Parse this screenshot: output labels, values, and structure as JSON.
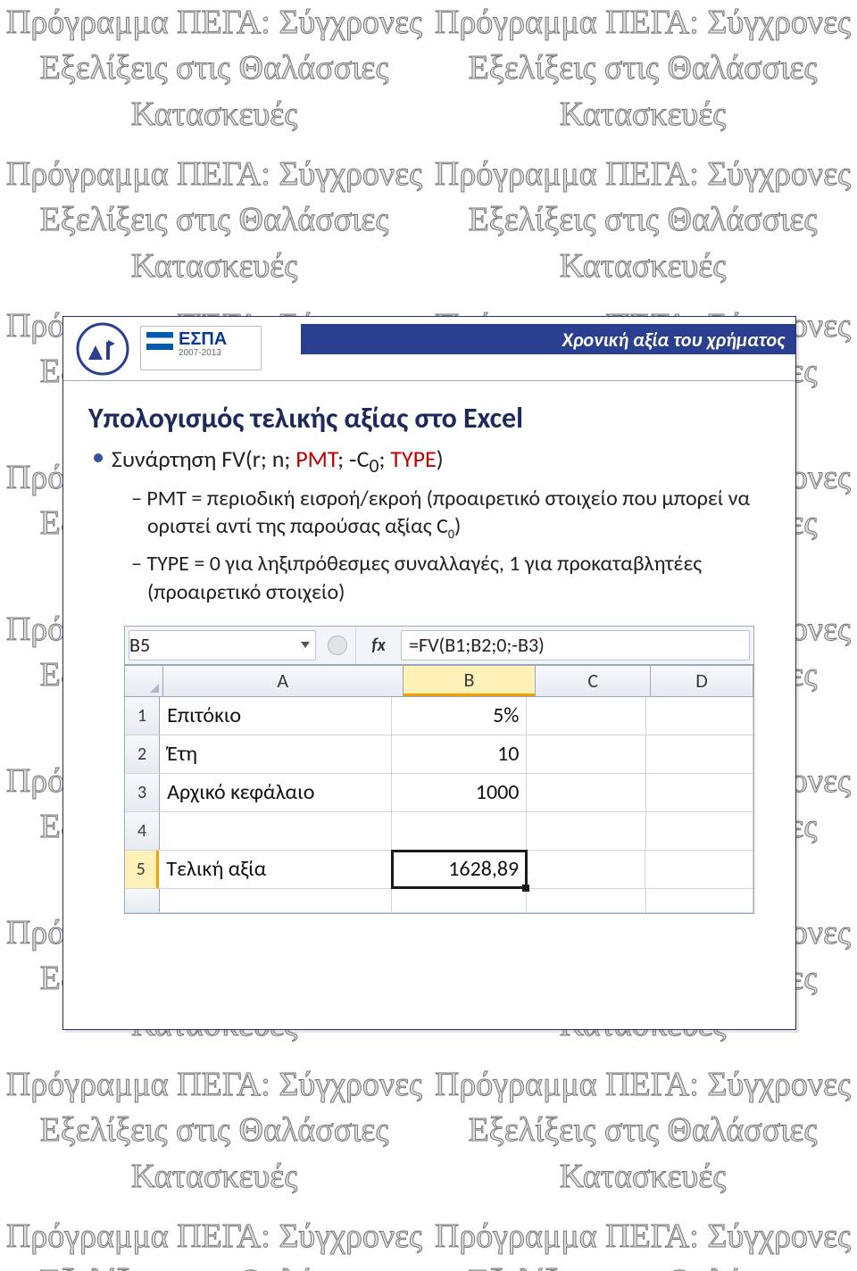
{
  "watermark_text": "Πρόγραμμα ΠΕΓΑ: Σύγχρονες Εξελίξεις στις Θαλάσσιες Κατασκευές",
  "slide": {
    "header_bar": "Χρονική αξία του χρήματος",
    "espa": {
      "brand": "ΕΣΠΑ",
      "years": "2007-2013"
    },
    "title": "Υπολογισμός τελικής αξίας στο Excel",
    "formula_line_pre": "Συνάρτηση FV(r; n; ",
    "formula_pmt": "PMT",
    "formula_mid1": "; ‑C",
    "formula_sub0": "0",
    "formula_mid2": "; ",
    "formula_type": "TYPE",
    "formula_end": ")",
    "sub1_pre": "PMT = περιοδική εισροή/εκροή (προαιρετικό στοιχείο που μπορεί να οριστεί αντί της παρούσας αξίας C",
    "sub1_sub": "0",
    "sub1_post": ")",
    "sub2": "TYPE = 0 για ληξιπρόθεσμες συναλλαγές, 1 για προκαταβλητέες (προαιρετικό στοιχείο)"
  },
  "chart_data": {
    "type": "table",
    "name_box": "B5",
    "fx_label": "fx",
    "formula": "=FV(B1;B2;0;-B3)",
    "col_headers": [
      "A",
      "B",
      "C",
      "D"
    ],
    "rows": [
      {
        "n": "1",
        "A": "Επιτόκιο",
        "B": "5%",
        "C": "",
        "D": ""
      },
      {
        "n": "2",
        "A": "Έτη",
        "B": "10",
        "C": "",
        "D": ""
      },
      {
        "n": "3",
        "A": "Αρχικό κεφάλαιο",
        "B": "1000",
        "C": "",
        "D": ""
      },
      {
        "n": "4",
        "A": "",
        "B": "",
        "C": "",
        "D": ""
      },
      {
        "n": "5",
        "A": "Τελική αξία",
        "B": "1628,89",
        "C": "",
        "D": ""
      }
    ]
  }
}
